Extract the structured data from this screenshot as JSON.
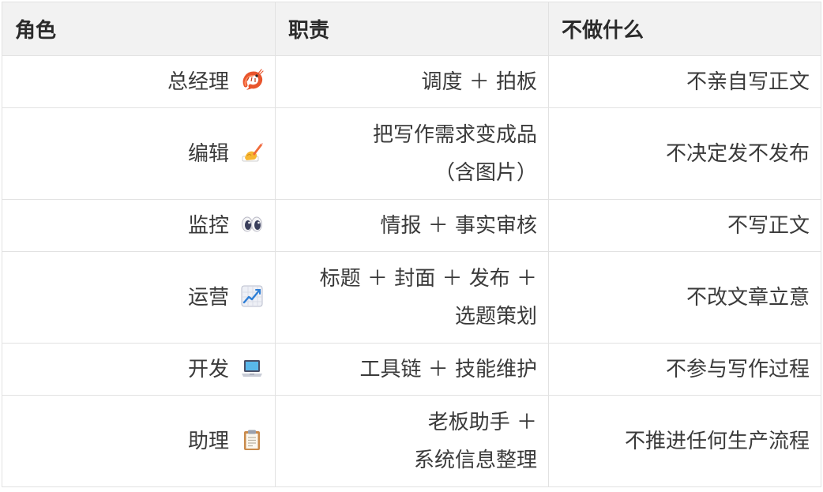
{
  "headers": [
    "角色",
    "职责",
    "不做什么"
  ],
  "rows": [
    {
      "role": "总经理",
      "icon": "shrimp-icon",
      "duty": [
        "调度 ＋ 拍板"
      ],
      "not_do": "不亲自写正文"
    },
    {
      "role": "编辑",
      "icon": "writing-hand-icon",
      "duty": [
        "把写作需求变成品",
        "（含图片）"
      ],
      "not_do": "不决定发不发布"
    },
    {
      "role": "监控",
      "icon": "eyes-icon",
      "duty": [
        "情报 ＋ 事实审核"
      ],
      "not_do": "不写正文"
    },
    {
      "role": "运营",
      "icon": "chart-increasing-icon",
      "duty": [
        "标题 ＋ 封面 ＋ 发布 ＋",
        "选题策划"
      ],
      "not_do": "不改文章立意"
    },
    {
      "role": "开发",
      "icon": "laptop-icon",
      "duty": [
        "工具链 ＋ 技能维护"
      ],
      "not_do": "不参与写作过程"
    },
    {
      "role": "助理",
      "icon": "clipboard-icon",
      "duty": [
        "老板助手 ＋",
        "系统信息整理"
      ],
      "not_do": "不推进任何生产流程"
    }
  ]
}
